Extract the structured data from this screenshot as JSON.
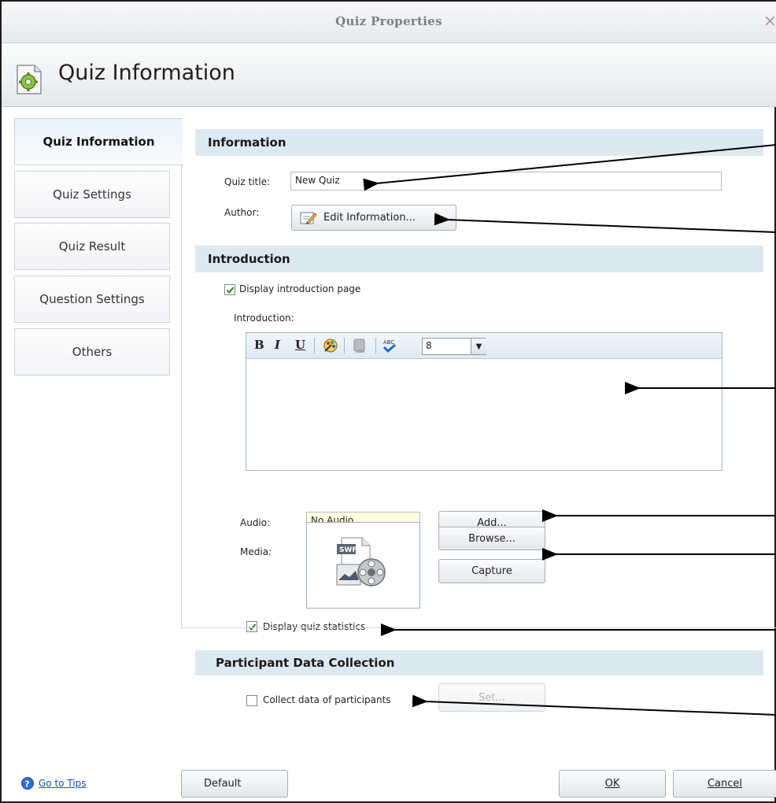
{
  "window": {
    "title": "Quiz Properties",
    "close_glyph": "×"
  },
  "header": {
    "title": "Quiz Information",
    "icon": "gear-document-icon"
  },
  "nav": {
    "items": [
      {
        "label": "Quiz Information",
        "active": true
      },
      {
        "label": "Quiz Settings",
        "active": false
      },
      {
        "label": "Quiz Result",
        "active": false
      },
      {
        "label": "Question Settings",
        "active": false
      },
      {
        "label": "Others",
        "active": false
      }
    ]
  },
  "information": {
    "section_title": "Information",
    "quiz_title_label": "Quiz title:",
    "quiz_title_value": "New Quiz",
    "author_label": "Author:",
    "edit_info_button": "Edit Information..."
  },
  "introduction": {
    "section_title": "Introduction",
    "display_intro_label": "Display introduction page",
    "display_intro_checked": true,
    "intro_label": "Introduction:",
    "toolbar": {
      "bold": "B",
      "italic": "I",
      "underline": "U",
      "font_size": "8"
    },
    "audio_label": "Audio:",
    "audio_value": "No Audio",
    "add_button": "Add...",
    "media_label": "Media:",
    "browse_button": "Browse...",
    "capture_button": "Capture",
    "swf_badge": "SWF",
    "display_stats_label": "Display quiz statistics",
    "display_stats_checked": true
  },
  "participant": {
    "section_title": "Participant Data Collection",
    "collect_label": "Collect data of participants",
    "collect_checked": false,
    "set_button": "Set..."
  },
  "footer": {
    "tips_link": "Go to Tips",
    "default_button": "Default",
    "ok_button": "OK",
    "cancel_button": "Cancel"
  },
  "colors": {
    "section_bg": "#dde9f1",
    "link": "#1a4fbf",
    "audio_field_bg": "#ffffe0"
  }
}
